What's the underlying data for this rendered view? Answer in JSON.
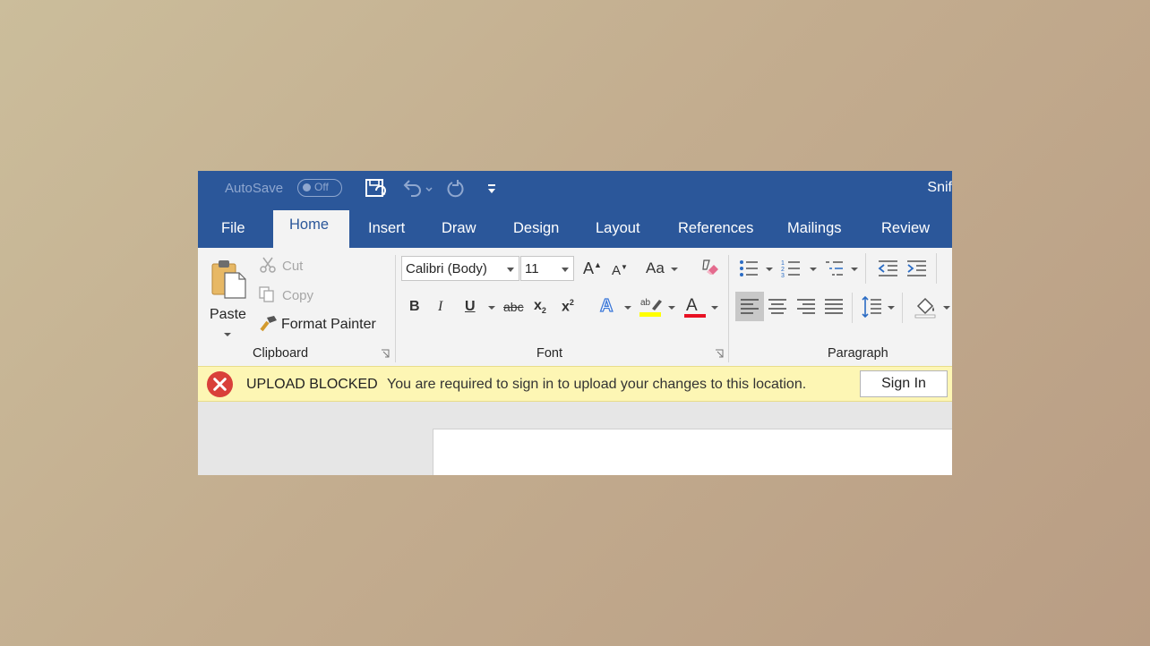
{
  "titlebar": {
    "autosave_label": "AutoSave",
    "autosave_state": "Off",
    "doc_name": "Snif",
    "icons": [
      "save-icon",
      "undo-icon",
      "redo-icon",
      "customize-qat-icon"
    ]
  },
  "tabs": [
    {
      "label": "File",
      "active": false
    },
    {
      "label": "Home",
      "active": true
    },
    {
      "label": "Insert",
      "active": false
    },
    {
      "label": "Draw",
      "active": false
    },
    {
      "label": "Design",
      "active": false
    },
    {
      "label": "Layout",
      "active": false
    },
    {
      "label": "References",
      "active": false
    },
    {
      "label": "Mailings",
      "active": false
    },
    {
      "label": "Review",
      "active": false
    }
  ],
  "clipboard": {
    "group_label": "Clipboard",
    "paste_label": "Paste",
    "cut_label": "Cut",
    "copy_label": "Copy",
    "format_painter_label": "Format Painter"
  },
  "font": {
    "group_label": "Font",
    "font_name": "Calibri (Body)",
    "font_size": "11",
    "change_case_label": "Aa",
    "bold": "B",
    "italic": "I",
    "underline": "U",
    "strikethrough": "abc",
    "subscript": "x",
    "subscript_mark": "2",
    "superscript": "x",
    "superscript_mark": "2",
    "grow_font": "A",
    "shrink_font": "A",
    "text_effects": "A",
    "font_color": "A"
  },
  "paragraph": {
    "group_label": "Paragraph"
  },
  "message_bar": {
    "title": "UPLOAD BLOCKED",
    "text": "You are required to sign in to upload your changes to this location.",
    "button_label": "Sign In"
  },
  "colors": {
    "accent": "#2b579a",
    "message_bar": "#fdf6b4",
    "error": "#d9403a",
    "highlight": "#ffff00",
    "font_color": "#e81123"
  }
}
